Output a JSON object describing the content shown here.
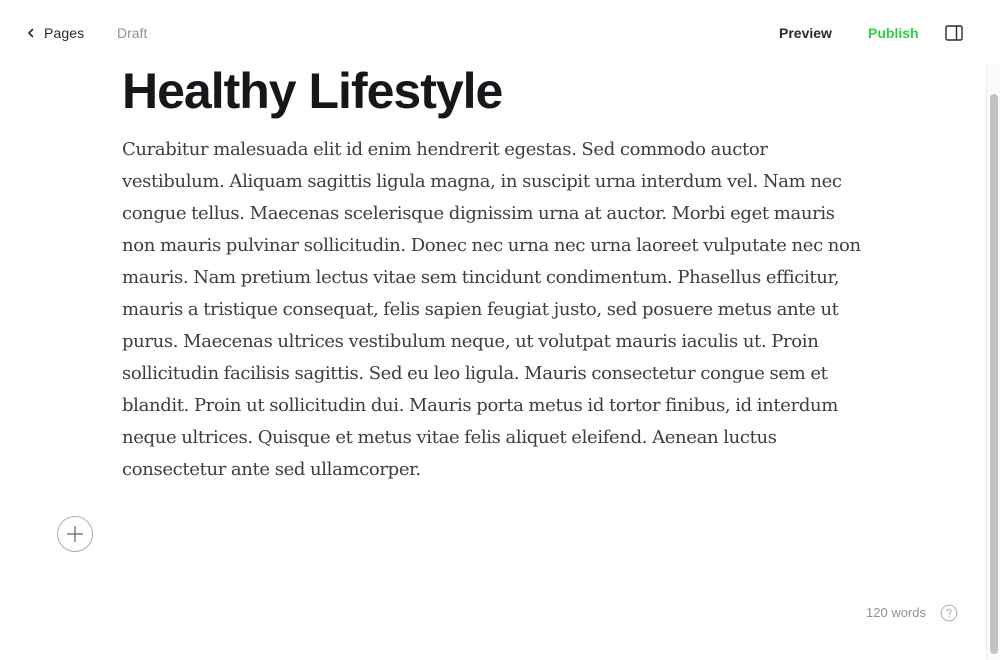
{
  "header": {
    "back_label": "Pages",
    "status_label": "Draft",
    "preview_label": "Preview",
    "publish_label": "Publish"
  },
  "post": {
    "title": "Healthy Lifestyle",
    "body": "Curabitur malesuada elit id enim hendrerit egestas. Sed commodo auctor vestibulum. Aliquam sagittis ligula magna, in suscipit urna interdum vel. Nam nec congue tellus. Maecenas scelerisque dignissim urna at auctor. Morbi eget mauris non mauris pulvinar sollicitudin. Donec nec urna nec urna laoreet vulputate nec non mauris. Nam pretium lectus vitae sem tincidunt condimentum. Phasellus efficitur, mauris a tristique consequat, felis sapien feugiat justo, sed posuere metus ante ut purus. Maecenas ultrices vestibulum neque, ut volutpat mauris iaculis ut. Proin sollicitudin facilisis sagittis. Sed eu leo ligula. Mauris consectetur congue sem et blandit. Proin ut sollicitudin dui. Mauris porta metus id tortor finibus, id interdum neque ultrices. Quisque et metus vitae felis aliquet eleifend. Aenean luctus consectetur ante sed ullamcorper."
  },
  "footer": {
    "word_count": "120 words"
  },
  "icons": {
    "back": "chevron-left-icon",
    "panel": "sidebar-panel-icon",
    "add": "plus-icon",
    "help": "question-circle-icon"
  },
  "colors": {
    "publish": "#30cf43",
    "muted": "#8d939c",
    "title": "#15171a",
    "body": "#3a3e44"
  }
}
